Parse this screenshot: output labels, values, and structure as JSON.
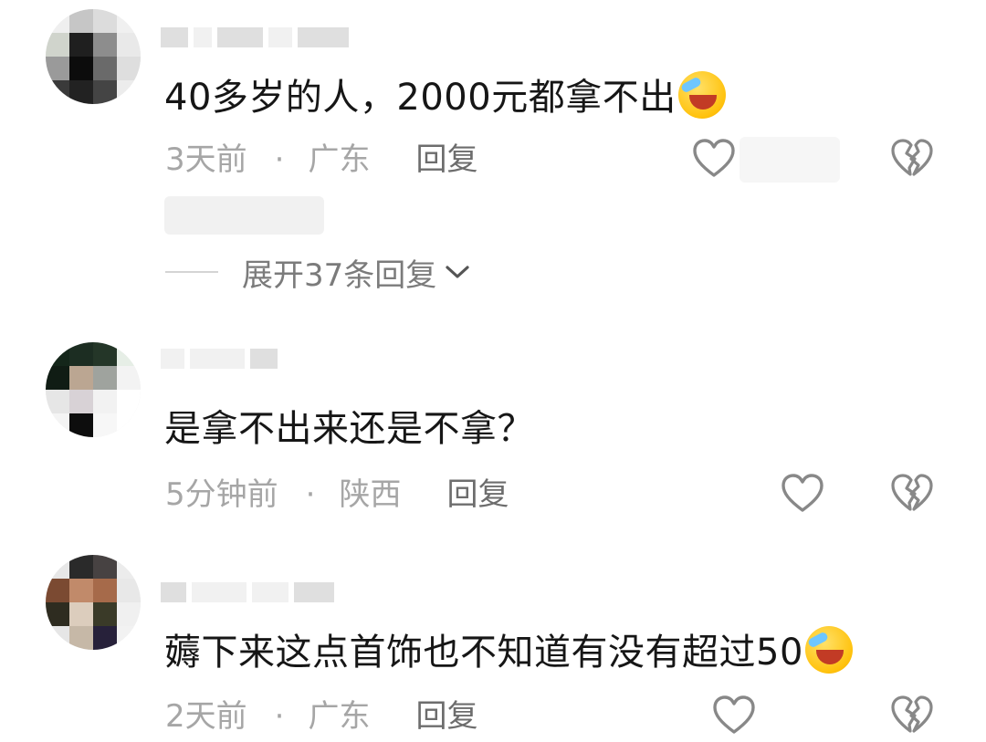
{
  "comments": [
    {
      "username": "",
      "text": "40多岁的人，2000元都拿不出",
      "emoji": "laughing-crying-emoji",
      "time": "3天前",
      "separator": "·",
      "location": "广东",
      "reply_label": "回复",
      "expand_label": "展开37条回复"
    },
    {
      "username": "",
      "text": "是拿不出来还是不拿？",
      "emoji": "",
      "time": "5分钟前",
      "separator": "·",
      "location": "陕西",
      "reply_label": "回复"
    },
    {
      "username": "",
      "text": "薅下来这点首饰也不知道有没有超过50",
      "emoji": "laughing-crying-emoji",
      "time": "2天前",
      "separator": "·",
      "location": "广东",
      "reply_label": "回复"
    }
  ],
  "icons": {
    "like": "heart-icon",
    "dislike": "broken-heart-icon",
    "expand": "chevron-down-icon"
  },
  "colors": {
    "text": "#161616",
    "meta": "#a6a6a6",
    "reply": "#6d6d6d",
    "icon": "#888888"
  }
}
